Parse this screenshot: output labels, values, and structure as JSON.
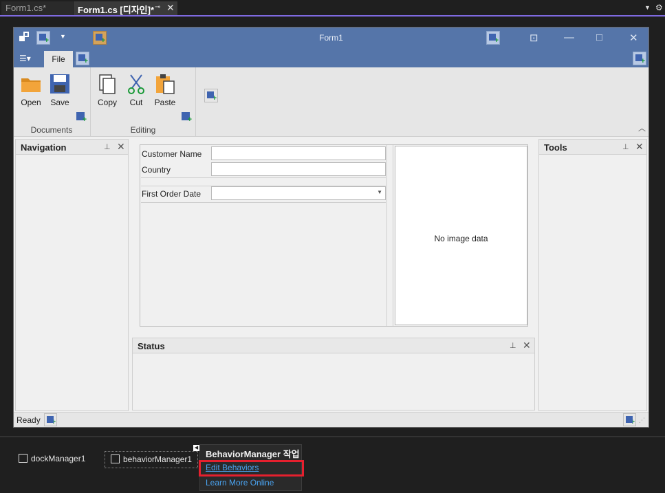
{
  "doc_tabs": [
    {
      "label": "Form1.cs*"
    },
    {
      "label": "Form1.cs [디자인]*"
    }
  ],
  "form": {
    "title": "Form1",
    "ribbon": {
      "tab_label": "File",
      "groups": [
        {
          "label": "Documents",
          "buttons": [
            {
              "label": "Open",
              "icon": "folder-icon"
            },
            {
              "label": "Save",
              "icon": "floppy-icon"
            }
          ]
        },
        {
          "label": "Editing",
          "buttons": [
            {
              "label": "Copy",
              "icon": "copy-icon"
            },
            {
              "label": "Cut",
              "icon": "scissors-icon"
            },
            {
              "label": "Paste",
              "icon": "paste-icon"
            }
          ]
        }
      ]
    },
    "panels": {
      "navigation": {
        "title": "Navigation"
      },
      "tools": {
        "title": "Tools"
      },
      "status": {
        "title": "Status"
      }
    },
    "layout": {
      "fields": [
        {
          "label": "Customer Name",
          "value": ""
        },
        {
          "label": "Country",
          "value": ""
        },
        {
          "label": "First Order Date",
          "value": ""
        }
      ],
      "picture_text": "No image data"
    },
    "statusbar": {
      "text": "Ready"
    }
  },
  "tray": {
    "items": [
      {
        "label": "dockManager1",
        "icon": "dock-manager-icon"
      },
      {
        "label": "behaviorManager1",
        "icon": "behavior-manager-icon"
      }
    ]
  },
  "smart_tag": {
    "title": "BehaviorManager 작업",
    "edit_behaviors": "Edit Behaviors",
    "learn_more": "Learn More Online",
    "highlight_color": "#e5202e"
  },
  "colors": {
    "titlebar": "#5575a9",
    "ribbon": "#e6e6e6",
    "accent": "#7f6ae0"
  }
}
